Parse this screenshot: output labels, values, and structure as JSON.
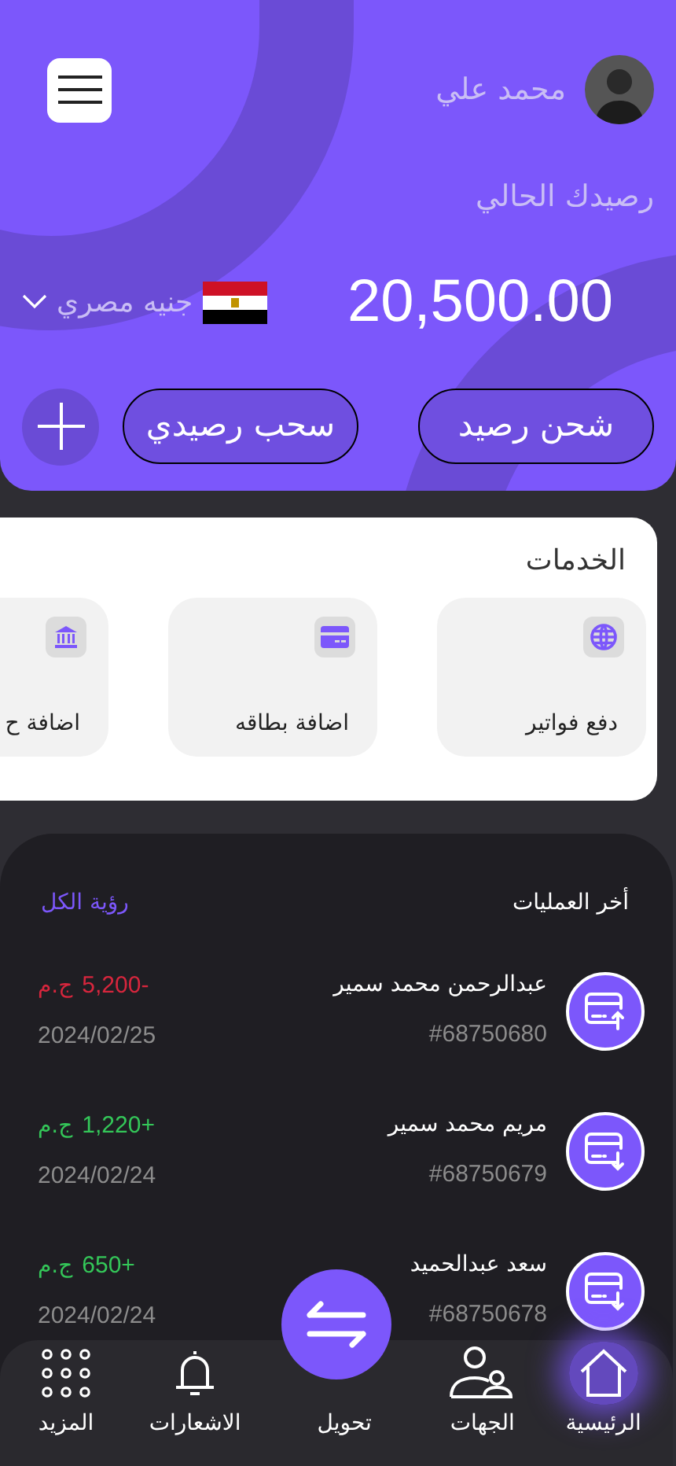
{
  "header": {
    "user_name": "محمد علي",
    "balance_label": "رصيدك الحالي",
    "balance": "20,500.00",
    "currency": "جنيه مصري",
    "actions": [
      {
        "label": "شحن رصيد"
      },
      {
        "label": "سحب رصيدي"
      }
    ]
  },
  "services": {
    "title": "الخدمات",
    "items": [
      {
        "kind": "globe",
        "label": "دفع فواتير"
      },
      {
        "kind": "card",
        "label": "اضافة بطاقه"
      },
      {
        "kind": "bank",
        "label": "اضافة ح"
      }
    ]
  },
  "transactions": {
    "title": "أخر العمليات",
    "view_all": "رؤية الكل",
    "items": [
      {
        "kind": "out",
        "name": "عبدالرحمن محمد سمير",
        "id": "#68750680",
        "amount": "5,200-",
        "currency": "ج.م",
        "date": "2024/02/25"
      },
      {
        "kind": "in",
        "name": "مريم محمد سمير",
        "id": "#68750679",
        "amount": "1,220+",
        "currency": "ج.م",
        "date": "2024/02/24"
      },
      {
        "kind": "in",
        "name": "سعد عبدالحميد",
        "id": "#68750678",
        "amount": "650+",
        "currency": "ج.م",
        "date": "2024/02/24"
      }
    ]
  },
  "bottom_nav": [
    {
      "kind": "home",
      "label": "الرئيسية",
      "selected": true
    },
    {
      "kind": "contacts",
      "label": "الجهات",
      "selected": false
    },
    {
      "kind": "transfer",
      "label": "تحويل",
      "selected": false
    },
    {
      "kind": "bell",
      "label": "الاشعارات",
      "selected": false
    },
    {
      "kind": "more",
      "label": "المزيد",
      "selected": false
    }
  ]
}
